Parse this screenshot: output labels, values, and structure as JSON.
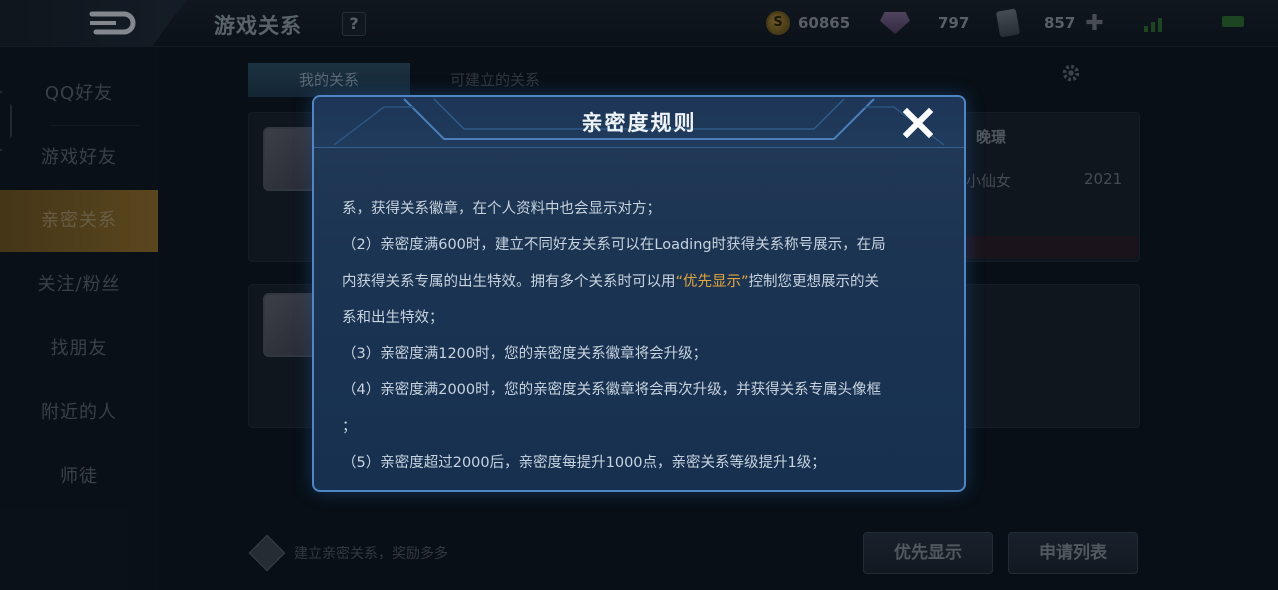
{
  "topbar": {
    "title": "游戏关系",
    "help": "?",
    "gold": "60865",
    "diamonds": "797",
    "vouchers": "857"
  },
  "sidebar": {
    "items": [
      {
        "label": "QQ好友"
      },
      {
        "label": "游戏好友"
      },
      {
        "label": "亲密关系"
      },
      {
        "label": "关注/粉丝"
      },
      {
        "label": "找朋友"
      },
      {
        "label": "附近的人"
      },
      {
        "label": "师徒"
      }
    ],
    "active_index": 2
  },
  "tabs": {
    "mine": "我的关系",
    "available": "可建立的关系"
  },
  "card1": {
    "name": "晚璟",
    "relation": "小仙女",
    "year": "2021"
  },
  "promo": {
    "text": "建立亲密关系，奖励多多"
  },
  "buttons": {
    "priority": "优先显示",
    "requests": "申请列表"
  },
  "modal": {
    "title": "亲密度规则",
    "lines": {
      "l1": "系，获得关系徽章，在个人资料中也会显示对方；",
      "l2": "（2）亲密度满600时，建立不同好友关系可以在Loading时获得关系称号展示，在局",
      "l3_before": "内获得关系专属的出生特效。拥有多个关系时可以用",
      "l3_highlight": "“优先显示”",
      "l3_after": "控制您更想展示的关",
      "l4": "系和出生特效；",
      "l5": "（3）亲密度满1200时，您的亲密度关系徽章将会升级；",
      "l6": "（4）亲密度满2000时，您的亲密度关系徽章将会再次升级，并获得关系专属头像框",
      "l7": "；",
      "l8": "（5）亲密度超过2000后，亲密度每提升1000点，亲密关系等级提升1级；"
    }
  },
  "colors": {
    "highlight": "#e4a53d",
    "active_tab": "#8b6d2e",
    "modal_border": "#4f86c3"
  }
}
